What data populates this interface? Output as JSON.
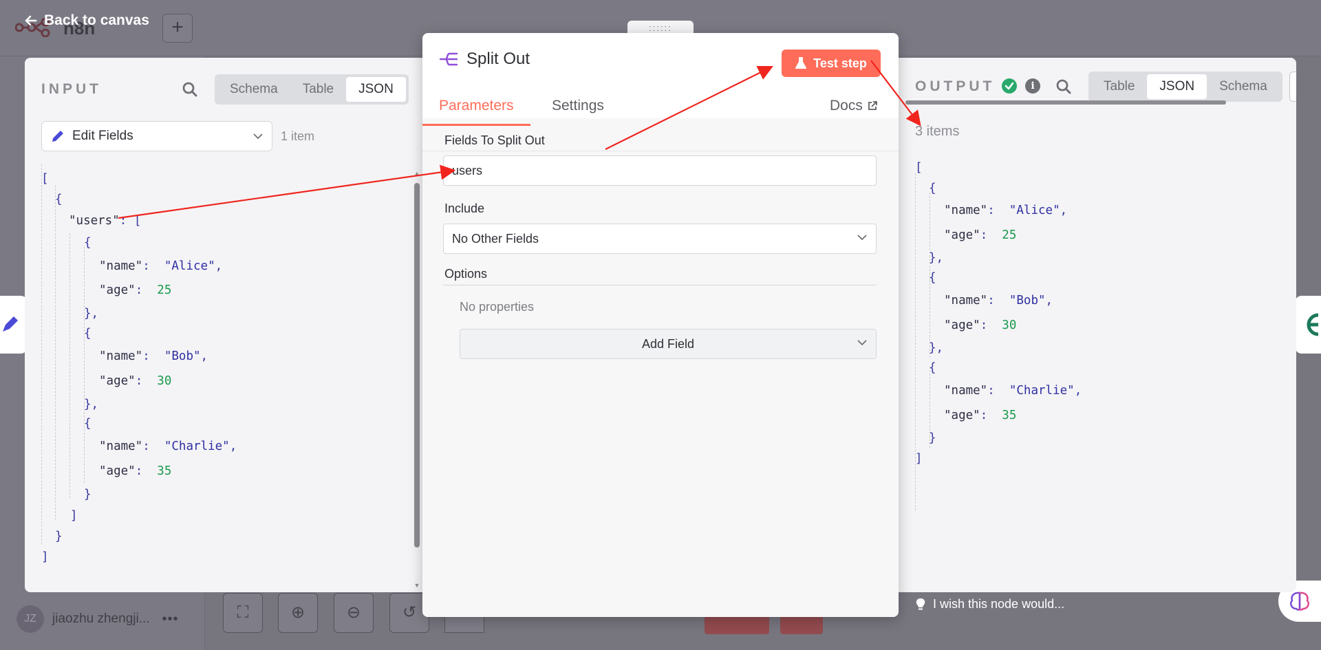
{
  "app": {
    "name": "n8n",
    "back_label": "Back to canvas",
    "user_initials": "JZ",
    "user_name": "jiaozhu zhengji...",
    "more_label": "•••",
    "add_label": "+"
  },
  "input_panel": {
    "label": "INPUT",
    "view_tabs": [
      "Schema",
      "Table",
      "JSON"
    ],
    "active_tab": "JSON",
    "node_select": "Edit Fields",
    "item_count": "1 item",
    "json": {
      "users": [
        {
          "name": "Alice",
          "age": 25
        },
        {
          "name": "Bob",
          "age": 30
        },
        {
          "name": "Charlie",
          "age": 35
        }
      ]
    }
  },
  "node": {
    "title": "Split Out",
    "test_button": "Test step",
    "tabs": [
      "Parameters",
      "Settings"
    ],
    "active_tab": "Parameters",
    "docs_label": "Docs",
    "drag_label": "::::::",
    "fields": {
      "split_label": "Fields To Split Out",
      "split_value": "users",
      "include_label": "Include",
      "include_value": "No Other Fields",
      "options_label": "Options",
      "no_properties": "No properties",
      "add_field": "Add Field"
    }
  },
  "output_panel": {
    "label": "OUTPUT",
    "view_tabs": [
      "Table",
      "JSON",
      "Schema"
    ],
    "active_tab": "JSON",
    "item_count": "3 items",
    "json": [
      {
        "name": "Alice",
        "age": 25
      },
      {
        "name": "Bob",
        "age": 30
      },
      {
        "name": "Charlie",
        "age": 35
      }
    ]
  },
  "feedback": {
    "label": "I wish this node would..."
  },
  "colors": {
    "accent": "#ff6d5a",
    "success": "#29a96b",
    "annotation_arrow": "#f0251e",
    "json_number": "#1b9a4d",
    "json_string": "#2f2fa3"
  }
}
